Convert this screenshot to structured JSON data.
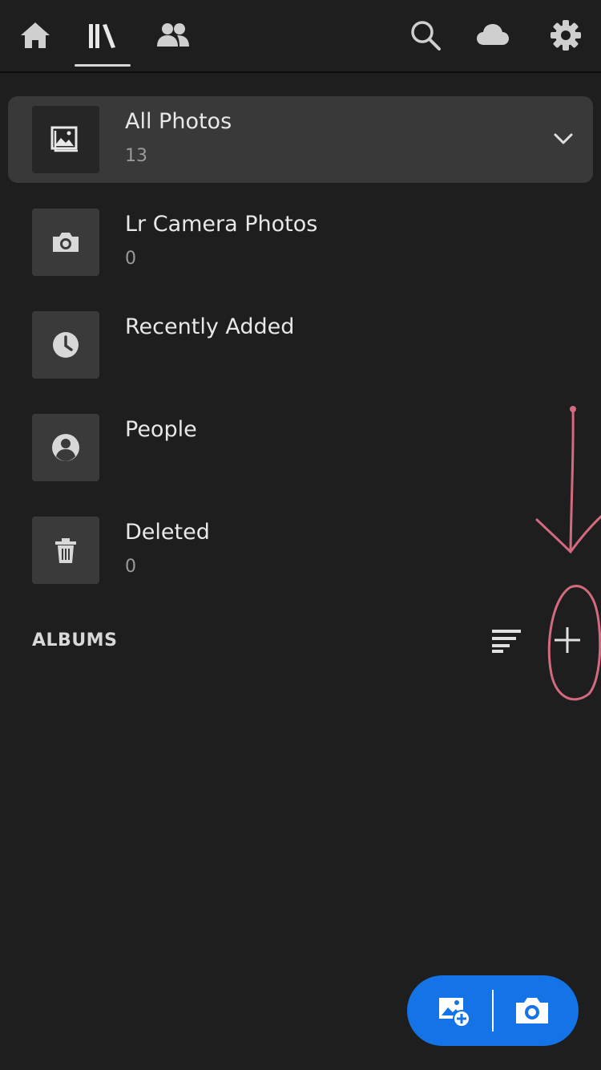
{
  "topbar": {
    "icons": [
      "home-icon",
      "library-icon",
      "people-icon",
      "search-icon",
      "cloud-icon",
      "gear-icon"
    ]
  },
  "sources": [
    {
      "title": "All Photos",
      "count": "13",
      "icon": "photos-icon",
      "selected": true
    },
    {
      "title": "Lr Camera Photos",
      "count": "0",
      "icon": "camera-icon"
    },
    {
      "title": "Recently Added",
      "count": "",
      "icon": "clock-icon"
    },
    {
      "title": "People",
      "count": "",
      "icon": "person-icon"
    },
    {
      "title": "Deleted",
      "count": "0",
      "icon": "trash-icon"
    }
  ],
  "albums": {
    "header": "ALBUMS"
  },
  "colors": {
    "background": "#1e1e1e",
    "selected_row": "#393939",
    "accent": "#1473e6",
    "annotation": "#d46a7e"
  }
}
